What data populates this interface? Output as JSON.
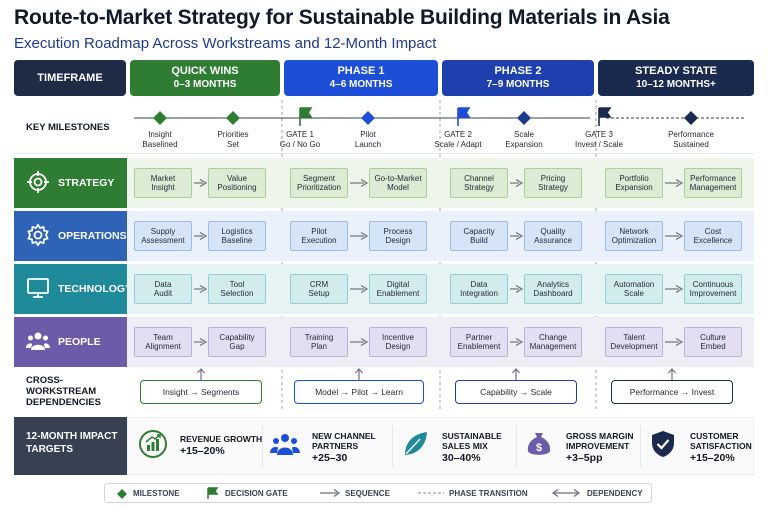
{
  "header": {
    "title": "Route-to-Market Strategy for Sustainable Building Materials in Asia",
    "subtitle": "Execution Roadmap Across Workstreams and 12-Month Impact"
  },
  "timeframe_label": "TIMEFRAME",
  "phases": [
    {
      "name": "QUICK WINS",
      "duration": "0–3 MONTHS",
      "color": "#2e7d32"
    },
    {
      "name": "PHASE 1",
      "duration": "4–6 MONTHS",
      "color": "#1d4ed8"
    },
    {
      "name": "PHASE 2",
      "duration": "7–9 MONTHS",
      "color": "#1e40af"
    },
    {
      "name": "STEADY STATE",
      "duration": "10–12 MONTHS+",
      "color": "#1a2a4e"
    }
  ],
  "milestones_label": "KEY MILESTONES",
  "milestones": [
    {
      "l1": "Insight",
      "l2": "Baselined",
      "kind": "diamond",
      "color": "#2e7d32"
    },
    {
      "l1": "Priorities",
      "l2": "Set",
      "kind": "diamond",
      "color": "#2e7d32"
    },
    {
      "l1": "GATE 1",
      "l2": "Go / No Go",
      "kind": "flag",
      "color": "#2e7d32"
    },
    {
      "l1": "Pilot",
      "l2": "Launch",
      "kind": "diamond",
      "color": "#1d4ed8"
    },
    {
      "l1": "GATE 2",
      "l2": "Scale / Adapt",
      "kind": "flag",
      "color": "#1d4ed8"
    },
    {
      "l1": "Scale",
      "l2": "Expansion",
      "kind": "diamond",
      "color": "#1e3a8a"
    },
    {
      "l1": "GATE 3",
      "l2": "Invest / Scale",
      "kind": "flag",
      "color": "#1a2a4e"
    },
    {
      "l1": "Performance",
      "l2": "Sustained",
      "kind": "diamond",
      "color": "#1a2a4e"
    }
  ],
  "workstreams": [
    {
      "name": "STRATEGY",
      "icon": "target-icon",
      "color": "#2e7d32",
      "band": "#eef5ea",
      "box_bg": "#dcebd3",
      "box_border": "#a9cf9a",
      "tasks": [
        [
          "Market",
          "Insight"
        ],
        [
          "Value",
          "Positioning"
        ],
        [
          "Segment",
          "Prioritization"
        ],
        [
          "Go-to-Market",
          "Model"
        ],
        [
          "Channel",
          "Strategy"
        ],
        [
          "Pricing",
          "Strategy"
        ],
        [
          "Portfolio",
          "Expansion"
        ],
        [
          "Performance",
          "Management"
        ]
      ]
    },
    {
      "name": "OPERATIONS",
      "icon": "gear-icon",
      "color": "#2e63b8",
      "band": "#eaf1fb",
      "box_bg": "#d6e4f7",
      "box_border": "#9dbbe6",
      "tasks": [
        [
          "Supply",
          "Assessment"
        ],
        [
          "Logistics",
          "Baseline"
        ],
        [
          "Pilot",
          "Execution"
        ],
        [
          "Process",
          "Design"
        ],
        [
          "Capacity",
          "Build"
        ],
        [
          "Quality",
          "Assurance"
        ],
        [
          "Network",
          "Optimization"
        ],
        [
          "Cost",
          "Excellence"
        ]
      ]
    },
    {
      "name": "TECHNOLOGY",
      "icon": "monitor-icon",
      "color": "#1f8a9a",
      "band": "#e6f4f5",
      "box_bg": "#d2ecee",
      "box_border": "#94cfd5",
      "tasks": [
        [
          "Data",
          "Audit"
        ],
        [
          "Tool",
          "Selection"
        ],
        [
          "CRM",
          "Setup"
        ],
        [
          "Digital",
          "Enablement"
        ],
        [
          "Data",
          "Integration"
        ],
        [
          "Analytics",
          "Dashboard"
        ],
        [
          "Automation",
          "Scale"
        ],
        [
          "Continuous",
          "Improvement"
        ]
      ]
    },
    {
      "name": "PEOPLE",
      "icon": "people-icon",
      "color": "#6c5ba8",
      "band": "#f0edf7",
      "box_bg": "#e3def1",
      "box_border": "#bbb0db",
      "tasks": [
        [
          "Team",
          "Alignment"
        ],
        [
          "Capability",
          "Gap"
        ],
        [
          "Training",
          "Plan"
        ],
        [
          "Incentive",
          "Design"
        ],
        [
          "Partner",
          "Enablement"
        ],
        [
          "Change",
          "Management"
        ],
        [
          "Talent",
          "Development"
        ],
        [
          "Culture",
          "Embed"
        ]
      ]
    }
  ],
  "dependencies_label": [
    "CROSS-WORKSTREAM",
    "DEPENDENCIES"
  ],
  "dependencies": [
    {
      "text": "Insight → Segments",
      "color": "#2e7d32"
    },
    {
      "text": "Model → Pilot → Learn",
      "color": "#1d4ed8"
    },
    {
      "text": "Capability → Scale",
      "color": "#1e40af"
    },
    {
      "text": "Performance → Invest",
      "color": "#1a2a4e"
    }
  ],
  "impact_label": [
    "12-MONTH IMPACT",
    "TARGETS"
  ],
  "impacts": [
    {
      "label": [
        "REVENUE GROWTH"
      ],
      "value": "+15–20%",
      "icon": "chart-growth-icon",
      "color": "#2e7d32"
    },
    {
      "label": [
        "NEW CHANNEL",
        "PARTNERS"
      ],
      "value": "+25–30",
      "icon": "people-icon",
      "color": "#1d4ed8"
    },
    {
      "label": [
        "SUSTAINABLE",
        "SALES MIX"
      ],
      "value": "30–40%",
      "icon": "leaf-icon",
      "color": "#1f8a9a"
    },
    {
      "label": [
        "GROSS MARGIN",
        "IMPROVEMENT"
      ],
      "value": "+3–5pp",
      "icon": "money-bag-icon",
      "color": "#6c5ba8"
    },
    {
      "label": [
        "CUSTOMER",
        "SATISFACTION"
      ],
      "value": "+15–20%",
      "icon": "shield-check-icon",
      "color": "#1a2a4e"
    }
  ],
  "legend": {
    "milestone": "MILESTONE",
    "gate": "DECISION GATE",
    "sequence": "SEQUENCE",
    "transition": "PHASE TRANSITION",
    "dependency": "DEPENDENCY"
  }
}
